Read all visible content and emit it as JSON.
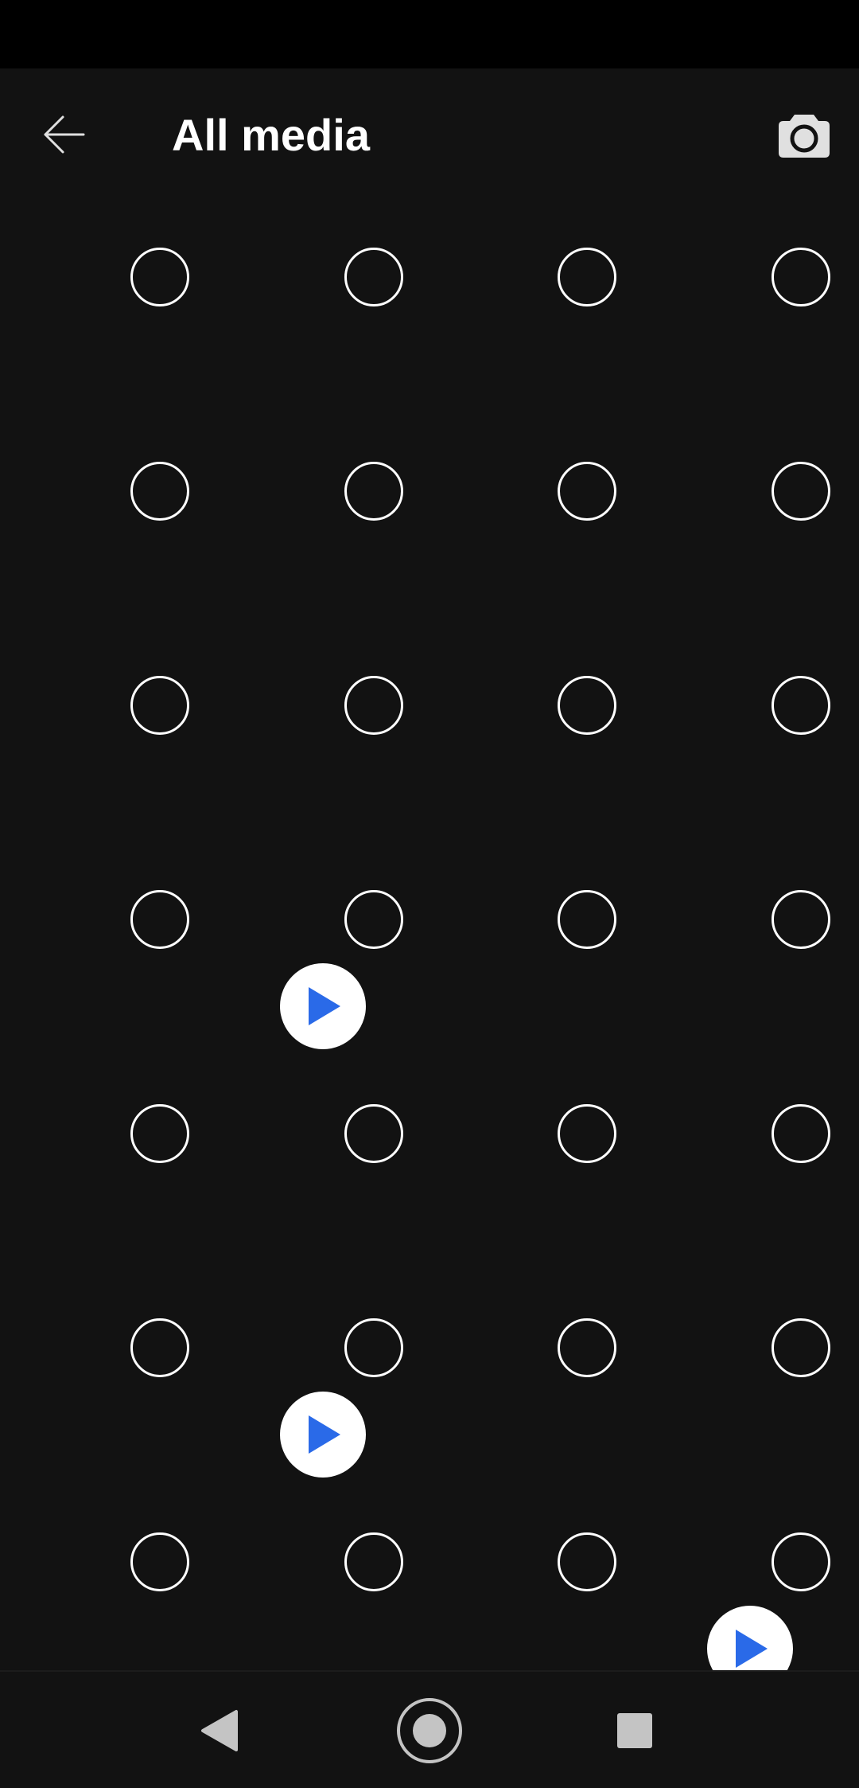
{
  "header": {
    "title": "All media",
    "back_icon": "arrow-left-icon",
    "camera_icon": "camera-icon"
  },
  "grid": {
    "rows": 7,
    "columns": 4,
    "video_tiles": [
      {
        "row": 3,
        "col": 1
      },
      {
        "row": 5,
        "col": 1
      },
      {
        "row": 6,
        "col": 3
      }
    ]
  },
  "nav": {
    "back_icon": "triangle-back-icon",
    "home_icon": "home-circle-icon",
    "recents_icon": "square-recents-icon"
  },
  "colors": {
    "background": "#121212",
    "status_bar": "#000000",
    "accent": "#2a6ae8",
    "icon_light": "#e0e0e0",
    "nav_icon": "#c4c4c4"
  }
}
